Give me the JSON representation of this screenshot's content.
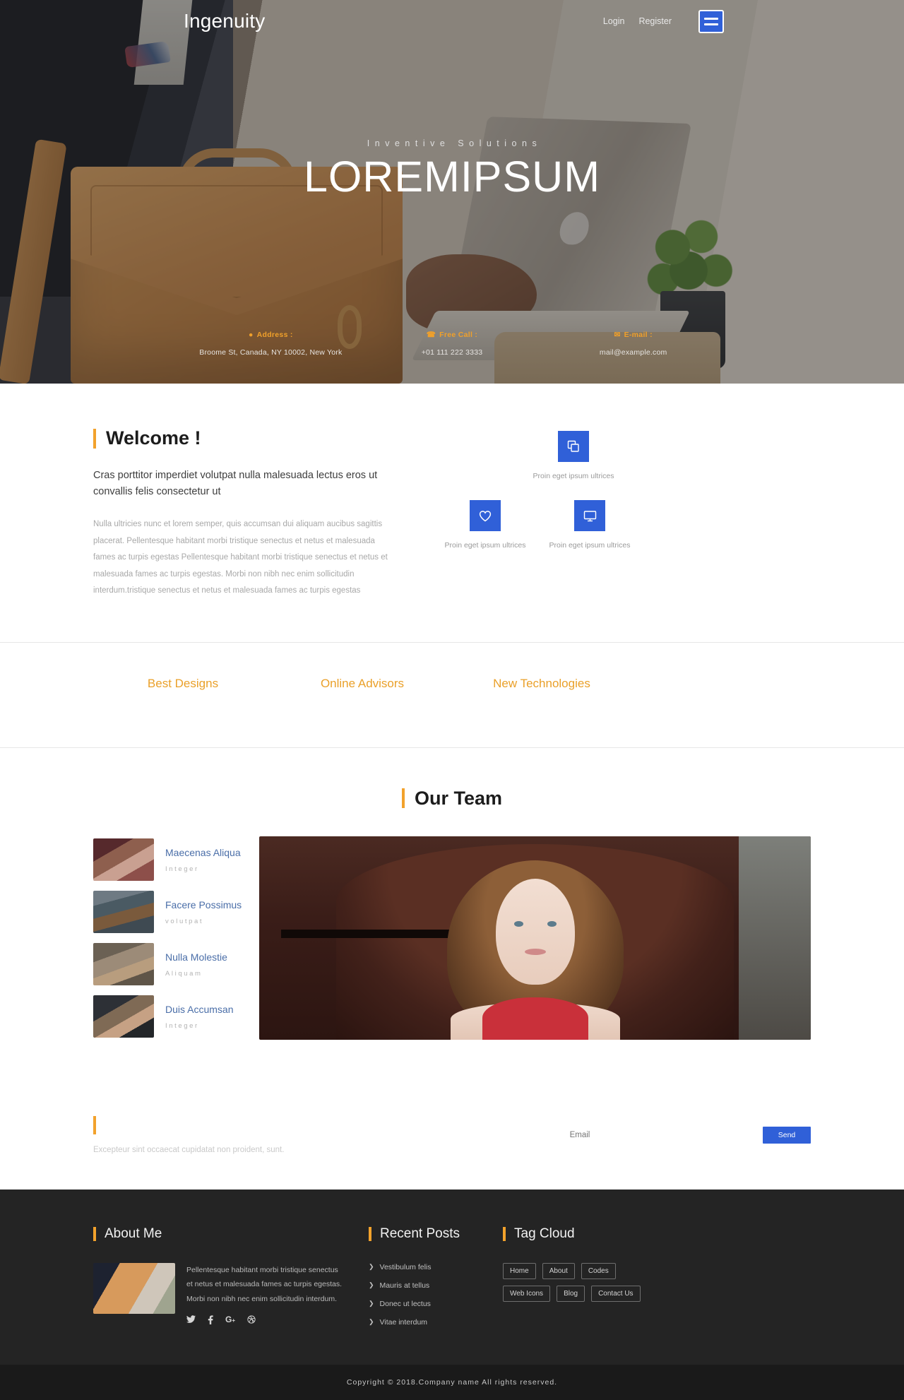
{
  "header": {
    "brand": "Ingenuity",
    "login": "Login",
    "register": "Register",
    "menu_icon": "hamburger-menu-icon"
  },
  "hero": {
    "subtitle": "Inventive Solutions",
    "title": "LOREMIPSUM",
    "contact": [
      {
        "icon": "location-pin-icon",
        "label": "Address :",
        "value": "Broome St, Canada, NY 10002, New York"
      },
      {
        "icon": "phone-icon",
        "label": "Free Call :",
        "value": "+01 111 222 3333"
      },
      {
        "icon": "envelope-icon",
        "label": "E-mail :",
        "value": "mail@example.com"
      }
    ]
  },
  "welcome": {
    "title": "Welcome !",
    "lead": "Cras porttitor imperdiet volutpat nulla malesuada lectus eros ut convallis felis consectetur ut",
    "body": "Nulla ultricies nunc et lorem semper, quis accumsan dui aliquam aucibus sagittis placerat. Pellentesque habitant morbi tristique senectus et netus et malesuada fames ac turpis egestas Pellentesque habitant morbi tristique senectus et netus et malesuada fames ac turpis egestas. Morbi non nibh nec enim sollicitudin interdum.tristique senectus et netus et malesuada fames ac turpis egestas",
    "features": [
      {
        "icon": "copy-layers-icon",
        "caption": "Proin eget ipsum ultrices"
      },
      {
        "icon": "heart-icon",
        "caption": "Proin eget ipsum ultrices"
      },
      {
        "icon": "monitor-icon",
        "caption": "Proin eget ipsum ultrices"
      }
    ]
  },
  "services": [
    {
      "title": "Best Designs"
    },
    {
      "title": "Online Advisors"
    },
    {
      "title": "New Technologies"
    },
    {
      "title": ""
    }
  ],
  "team": {
    "title": "Our Team",
    "members": [
      {
        "name": "Maecenas Aliqua",
        "role": "Integer"
      },
      {
        "name": "Facere Possimus",
        "role": "volutpat"
      },
      {
        "name": "Nulla Molestie",
        "role": "Aliquam"
      },
      {
        "name": "Duis Accumsan",
        "role": "Integer"
      }
    ]
  },
  "newsletter": {
    "title": "",
    "desc": "Excepteur sint occaecat cupidatat non proident, sunt.",
    "email_placeholder": "Email",
    "send_label": "Send"
  },
  "footer": {
    "about": {
      "title": "About Me",
      "text": "Pellentesque habitant morbi tristique senectus et netus et malesuada fames ac turpis egestas. Morbi non nibh nec enim sollicitudin interdum.",
      "socials": [
        {
          "icon": "twitter-icon",
          "glyph": "🐦"
        },
        {
          "icon": "facebook-icon",
          "glyph": "f"
        },
        {
          "icon": "google-plus-icon",
          "glyph": "G+"
        },
        {
          "icon": "dribbble-icon",
          "glyph": "⊛"
        }
      ]
    },
    "recent_posts": {
      "title": "Recent Posts",
      "items": [
        "Vestibulum felis",
        "Mauris at tellus",
        "Donec ut lectus",
        "Vitae interdum"
      ]
    },
    "tag_cloud": {
      "title": "Tag Cloud",
      "tags": [
        "Home",
        "About",
        "Codes",
        "Web Icons",
        "Blog",
        "Contact Us"
      ]
    },
    "copyright": "Copyright © 2018.Company name All rights reserved."
  },
  "colors": {
    "accent_orange": "#f2a22c",
    "accent_blue": "#3060d8",
    "link_blue": "#4a6ea8",
    "footer_bg": "#242424",
    "copyright_bg": "#1a1a1a"
  }
}
